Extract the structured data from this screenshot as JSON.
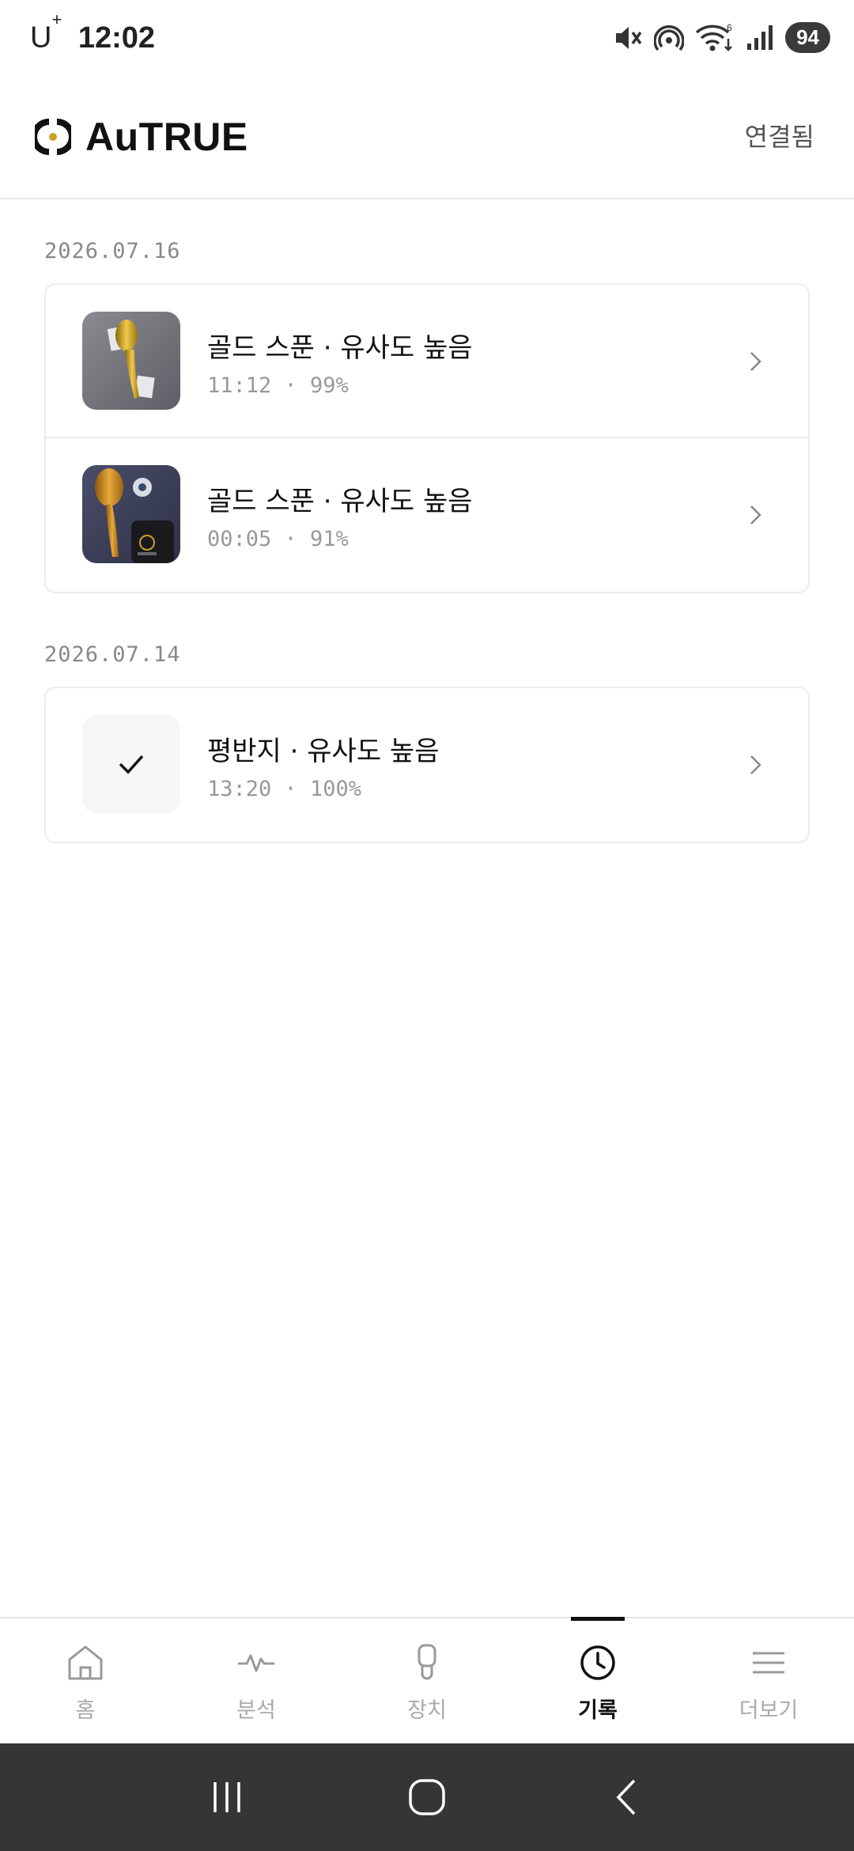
{
  "status_bar": {
    "carrier": "U",
    "carrier_sup": "+",
    "time": "12:02",
    "battery": "94"
  },
  "header": {
    "logo_text": "AuTRUE",
    "connection_status": "연결됨"
  },
  "history": {
    "groups": [
      {
        "date": "2026.07.16",
        "items": [
          {
            "title": "골드 스푼 · 유사도 높음",
            "subtitle": "11:12 · 99%",
            "thumb": "gold-spoon-photo"
          },
          {
            "title": "골드 스푼 · 유사도 높음",
            "subtitle": "00:05 · 91%",
            "thumb": "gold-spoon-device-photo"
          }
        ]
      },
      {
        "date": "2026.07.14",
        "items": [
          {
            "title": "평반지 · 유사도 높음",
            "subtitle": "13:20 · 100%",
            "thumb": "check-icon"
          }
        ]
      }
    ]
  },
  "nav": {
    "items": [
      {
        "label": "홈",
        "icon": "home-icon"
      },
      {
        "label": "분석",
        "icon": "pulse-icon"
      },
      {
        "label": "장치",
        "icon": "device-icon"
      },
      {
        "label": "기록",
        "icon": "clock-icon",
        "active": true
      },
      {
        "label": "더보기",
        "icon": "menu-icon"
      }
    ]
  },
  "colors": {
    "accent": "#111111",
    "muted": "#999999",
    "gold": "#c9a227"
  }
}
